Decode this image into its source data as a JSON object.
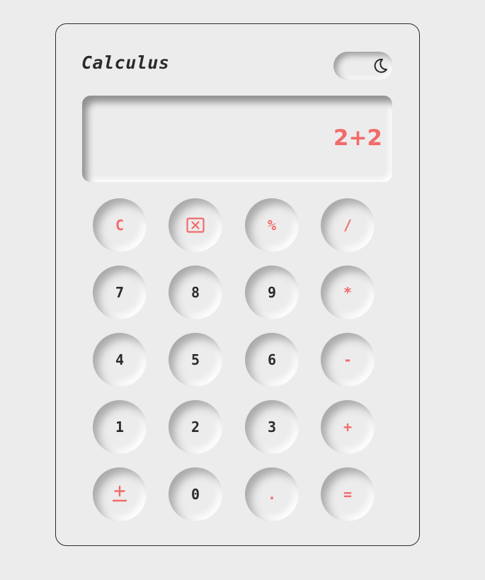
{
  "app": {
    "title": "Calculus"
  },
  "theme_toggle": {
    "icon": "moon-icon"
  },
  "display": {
    "expression": "2+2"
  },
  "colors": {
    "background": "#ececec",
    "accent": "#f26b6b",
    "text": "#2b2b2b"
  },
  "keys": {
    "clear": "C",
    "backspace_icon": "backspace-icon",
    "percent": "%",
    "divide": "/",
    "seven": "7",
    "eight": "8",
    "nine": "9",
    "multiply": "*",
    "four": "4",
    "five": "5",
    "six": "6",
    "minus": "-",
    "one": "1",
    "two": "2",
    "three": "3",
    "plus": "+",
    "plus_minus_icon": "plus-minus-icon",
    "zero": "0",
    "decimal": ".",
    "equals": "="
  }
}
